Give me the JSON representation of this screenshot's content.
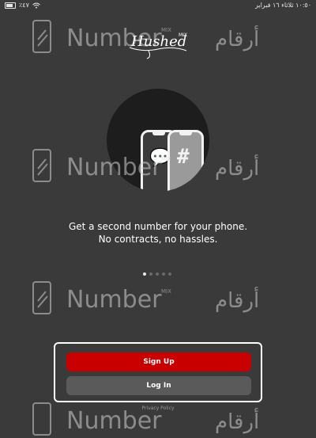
{
  "status_bar": {
    "time_date": "١٠:٥٠ ثلاثاء ١٦ فبراير",
    "battery_percent": "٪٤٧",
    "wifi_icon": "wifi-icon",
    "battery_icon": "battery-icon"
  },
  "logo": {
    "text": "Hushed",
    "badge": "MIX"
  },
  "watermark": {
    "latin": "Number",
    "badge": "MIX",
    "arabic": "أرقام"
  },
  "tagline": {
    "line1": "Get a second number for your phone.",
    "line2": "No contracts, no hassles."
  },
  "pagination": {
    "total": 5,
    "active": 1
  },
  "buttons": {
    "signup": "Sign Up",
    "login": "Log In"
  },
  "footer": {
    "privacy": "Privacy Policy"
  },
  "colors": {
    "background": "#3a3a3a",
    "primary": "#c90000",
    "secondary": "#5a5a5a"
  }
}
